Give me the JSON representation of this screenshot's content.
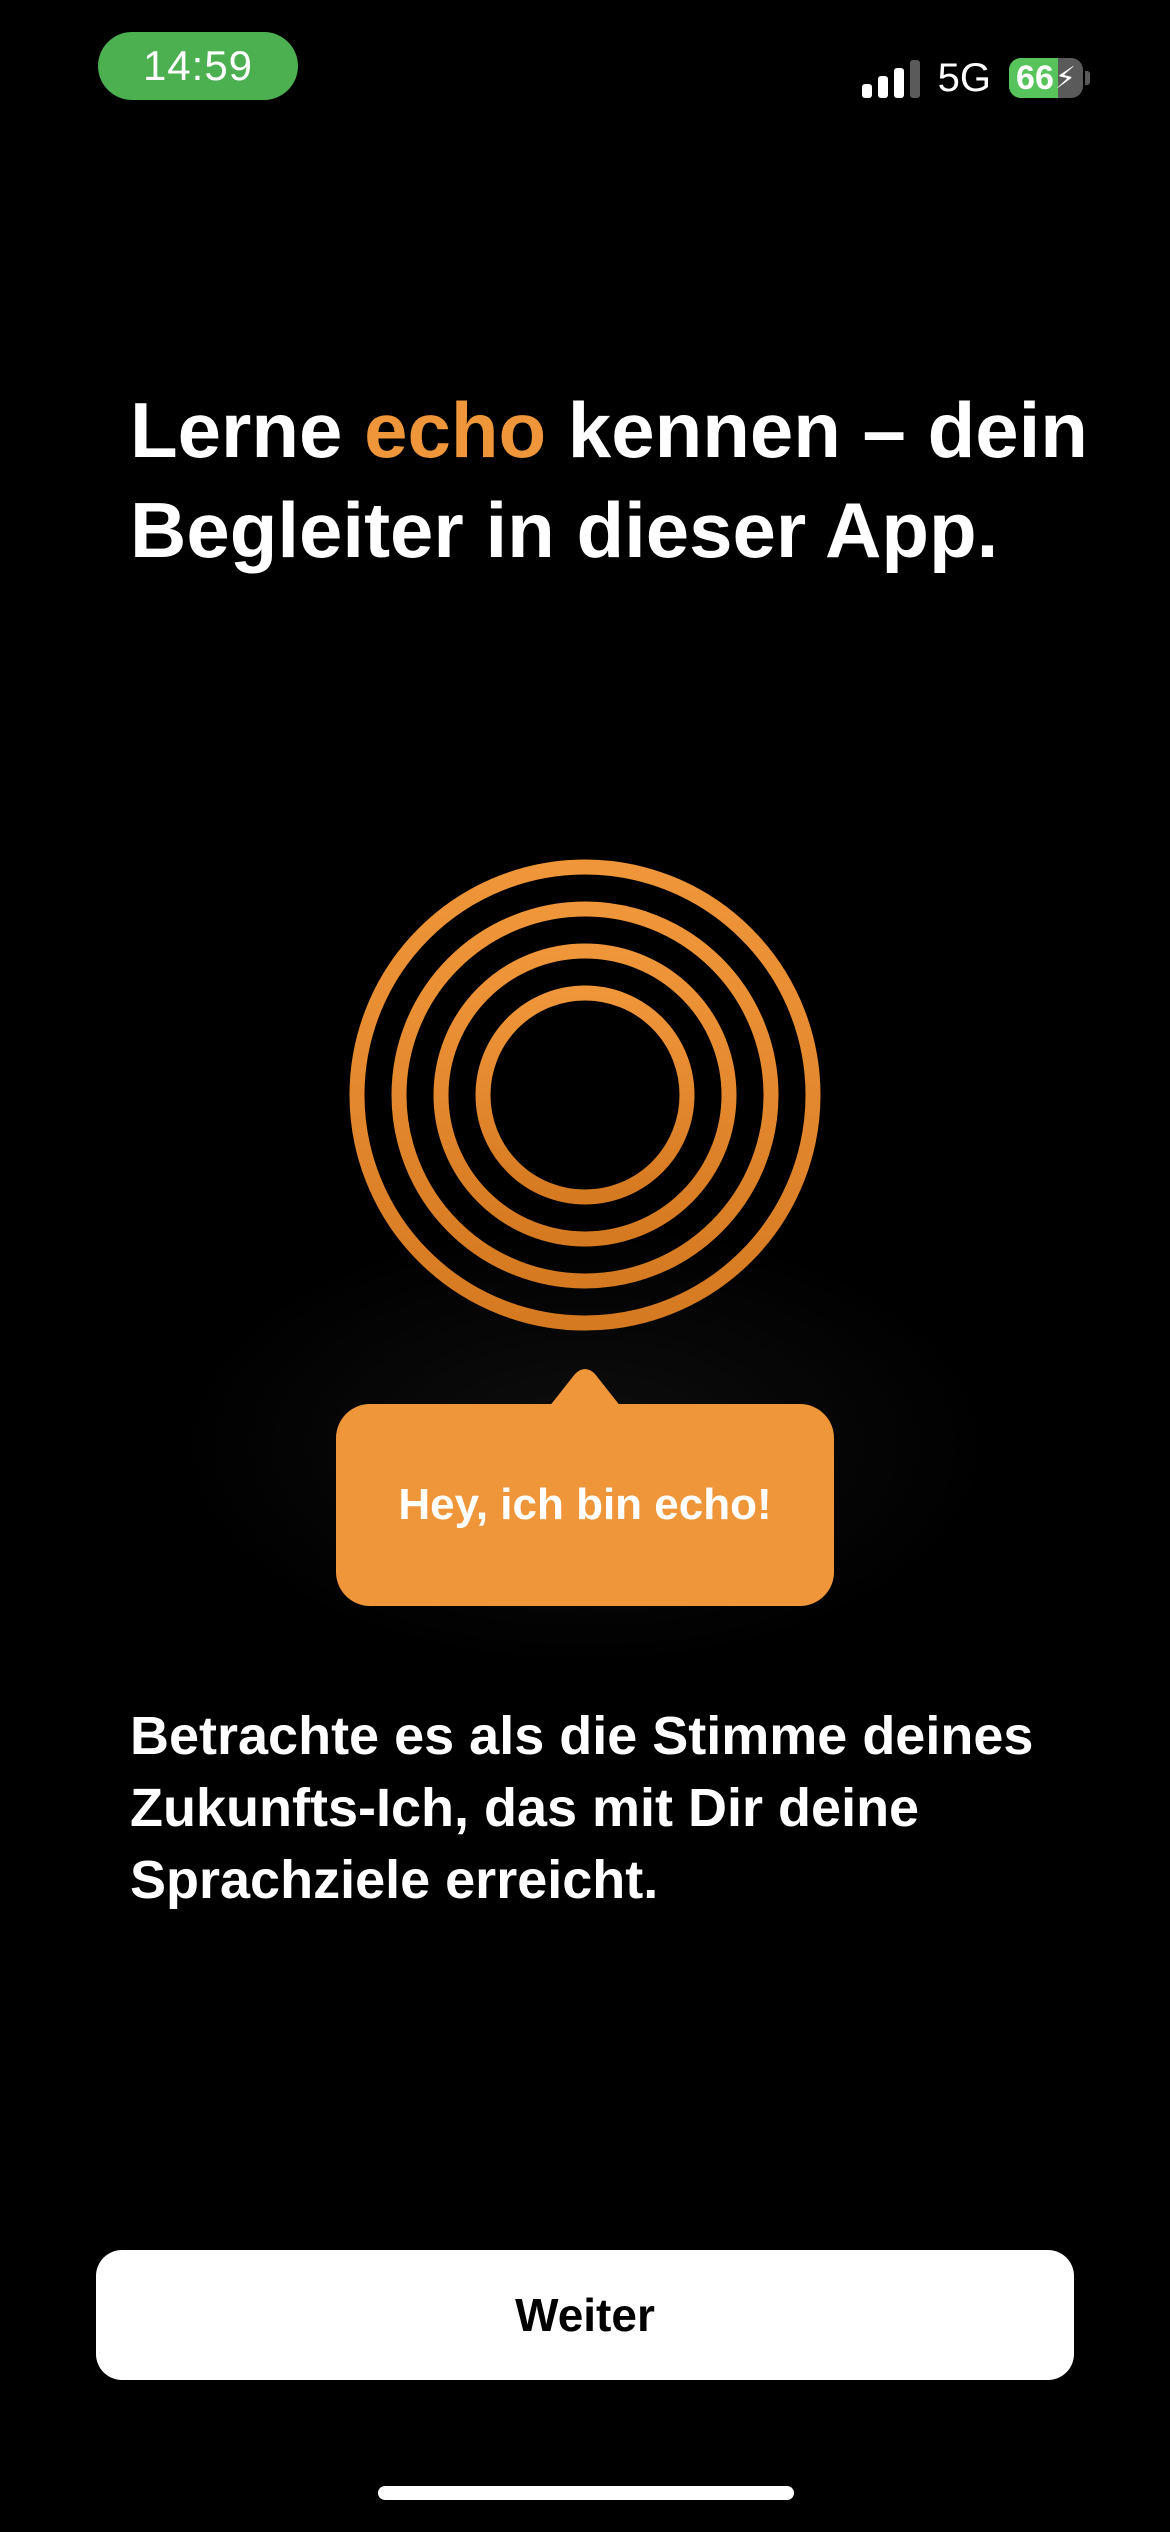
{
  "status_bar": {
    "time": "14:59",
    "network": "5G",
    "battery_level": "66",
    "battery_fraction": 0.66,
    "signal_bars_active": 3,
    "signal_bars_total": 4
  },
  "onboarding": {
    "title_before": "Lerne ",
    "title_accent": "echo",
    "title_after": " kennen – dein Begleiter in dieser App.",
    "bubble_text": "Hey, ich bin echo!",
    "description": "Betrachte es als die Stimme deines Zukunfts-Ich, das mit Dir deine Sprachziele erreicht.",
    "continue_label": "Weiter"
  },
  "colors": {
    "accent": "#f0963a",
    "accent_dark": "#d67a22",
    "background": "#000000",
    "time_pill": "#4cb050",
    "battery_fill": "#56c45b"
  }
}
